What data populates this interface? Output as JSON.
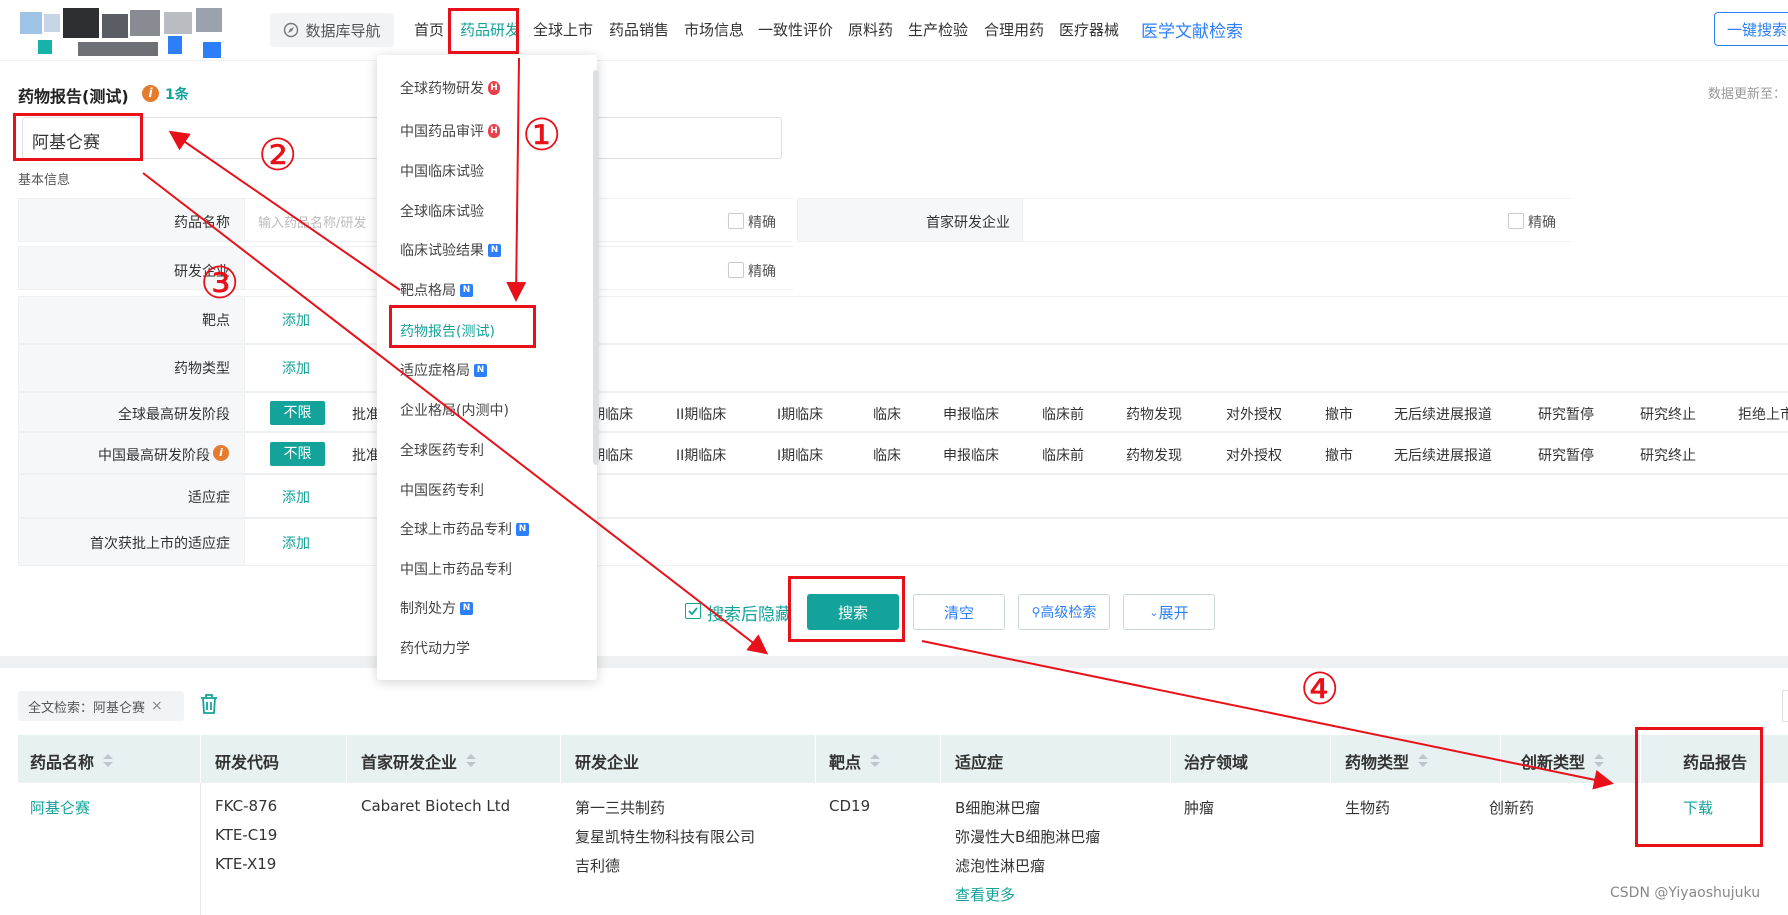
{
  "nav": {
    "db_nav": "数据库导航",
    "items": [
      "首页",
      "药品研发",
      "全球上市",
      "药品销售",
      "市场信息",
      "一致性评价",
      "原料药",
      "生产检验",
      "合理用药",
      "医疗器械"
    ],
    "literature_search": "医学文献检索",
    "quick_search": "一键搜索"
  },
  "page": {
    "title": "药物报告(测试)",
    "info_icon": "i",
    "count": "1条",
    "update_note": "数据更新至：",
    "keyword": "阿基仑赛",
    "section": "基本信息"
  },
  "form": {
    "drug_name_label": "药品名称",
    "drug_name_placeholder": "输入药品名称/研发",
    "exact": "精确",
    "first_company_label": "首家研发企业",
    "company_label": "研发企业",
    "target_label": "靶点",
    "drug_type_label": "药物类型",
    "global_stage_label": "全球最高研发阶段",
    "china_stage_label": "中国最高研发阶段",
    "indication_label": "适应症",
    "first_approved_label": "首次获批上市的适应症",
    "add": "添加",
    "unlimited": "不限",
    "approved_partial": "批准",
    "stages_global": [
      "I期临床",
      "II期临床",
      "I期临床",
      "临床",
      "申报临床",
      "临床前",
      "药物发现",
      "对外授权",
      "撤市",
      "无后续进展报道",
      "研究暂停",
      "研究终止",
      "拒绝上市"
    ],
    "stages_china": [
      "I期临床",
      "II期临床",
      "I期临床",
      "临床",
      "申报临床",
      "临床前",
      "药物发现",
      "对外授权",
      "撤市",
      "无后续进展报道",
      "研究暂停",
      "研究终止"
    ]
  },
  "actions": {
    "hide_after_search": "搜索后隐藏",
    "search": "搜索",
    "clear": "清空",
    "advanced": "高级检索",
    "expand": "展开"
  },
  "filter": {
    "chip": "全文检索：阿基仑赛"
  },
  "table": {
    "headers": [
      "药品名称",
      "研发代码",
      "首家研发企业",
      "研发企业",
      "靶点",
      "适应症",
      "治疗领域",
      "药物类型",
      "创新类型",
      "药品报告"
    ],
    "row": {
      "name": "阿基仑赛",
      "codes": [
        "FKC-876",
        "KTE-C19",
        "KTE-X19"
      ],
      "first_company": "Cabaret Biotech Ltd",
      "companies": [
        "第一三共制药",
        "复星凯特生物科技有限公司",
        "吉利德"
      ],
      "target": "CD19",
      "indications": [
        "B细胞淋巴瘤",
        "弥漫性大B细胞淋巴瘤",
        "滤泡性淋巴瘤"
      ],
      "more": "查看更多",
      "therapy_area": "肿瘤",
      "drug_type": "生物药",
      "innovation": "创新药",
      "report": "下载"
    }
  },
  "dropdown": {
    "items": [
      {
        "label": "全球药物研发",
        "badge": "H"
      },
      {
        "label": "中国药品审评",
        "badge": "H"
      },
      {
        "label": "中国临床试验",
        "badge": ""
      },
      {
        "label": "全球临床试验",
        "badge": ""
      },
      {
        "label": "临床试验结果",
        "badge": "N"
      },
      {
        "label": "靶点格局",
        "badge": "N"
      },
      {
        "label": "药物报告(测试)",
        "badge": ""
      },
      {
        "label": "适应症格局",
        "badge": "N"
      },
      {
        "label": "企业格局(内测中)",
        "badge": ""
      },
      {
        "label": "全球医药专利",
        "badge": ""
      },
      {
        "label": "中国医药专利",
        "badge": ""
      },
      {
        "label": "全球上市药品专利",
        "badge": "N"
      },
      {
        "label": "中国上市药品专利",
        "badge": ""
      },
      {
        "label": "制剂处方",
        "badge": "N"
      },
      {
        "label": "药代动力学",
        "badge": ""
      }
    ]
  },
  "annotations": [
    "①",
    "②",
    "③",
    "④"
  ],
  "watermark": "CSDN @Yiyaoshujuku",
  "colors": {
    "accent": "#14a39a",
    "link_blue": "#2d7ff9",
    "annotation_red": "#e8111a"
  }
}
